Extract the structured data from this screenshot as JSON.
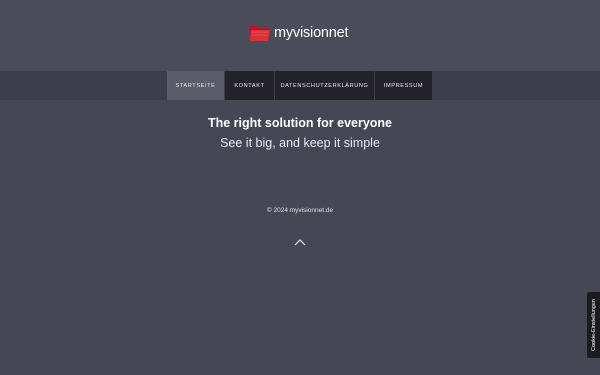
{
  "header": {
    "logo_text": "myvisionnet",
    "logo_icon": "folder-icon",
    "accent_color": "#c8262c"
  },
  "nav": {
    "items": [
      {
        "label": "STARTSEITE",
        "active": true
      },
      {
        "label": "KONTAKT",
        "active": false
      },
      {
        "label": "DATENSCHUTZERKLÄRUNG",
        "active": false
      },
      {
        "label": "IMPRESSUM",
        "active": false
      }
    ]
  },
  "hero": {
    "title": "The right solution for everyone",
    "subtitle": "See it big, and keep it simple"
  },
  "footer": {
    "copyright": "© 2024 myvisionnet.de",
    "scroll_top_icon": "chevron-up-icon"
  },
  "cookie_settings": {
    "label": "Cookie-Einstellungen"
  },
  "colors": {
    "background": "#454755",
    "nav_bar": "#3c3e4b",
    "nav_item": "#232329",
    "nav_item_active": "#5a5c6a"
  }
}
